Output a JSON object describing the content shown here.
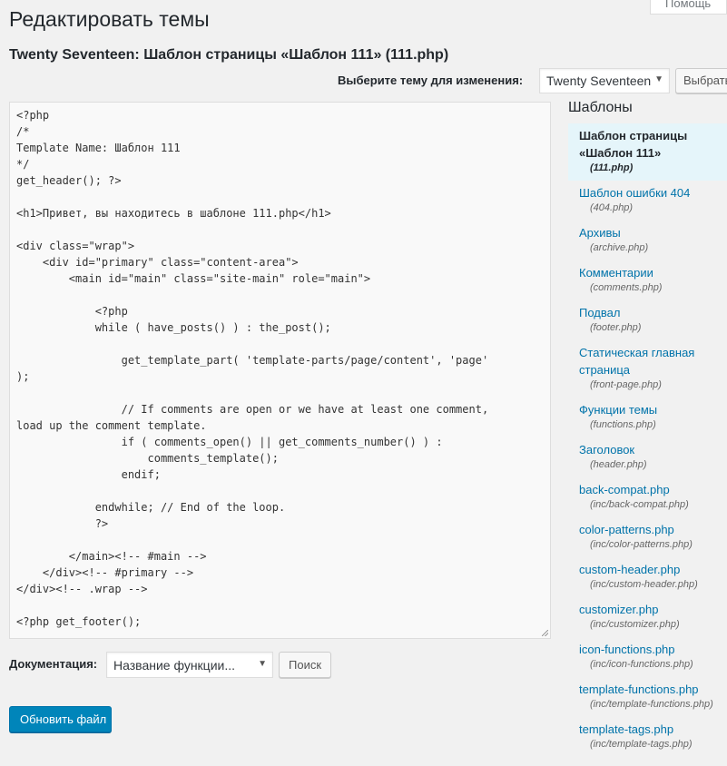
{
  "header": {
    "help_tab": "Помощь",
    "page_title": "Редактировать темы",
    "file_title": "Twenty Seventeen: Шаблон страницы «Шаблон 111» (111.php)"
  },
  "theme_picker": {
    "label": "Выберите тему для изменения:",
    "selected": "Twenty Seventeen",
    "button": "Выбрать"
  },
  "editor": {
    "code": "<?php\n/*\nTemplate Name: Шаблон 111\n*/\nget_header(); ?>\n\n<h1>Привет, вы находитесь в шаблоне 111.php</h1>\n\n<div class=\"wrap\">\n    <div id=\"primary\" class=\"content-area\">\n        <main id=\"main\" class=\"site-main\" role=\"main\">\n\n            <?php\n            while ( have_posts() ) : the_post();\n\n                get_template_part( 'template-parts/page/content', 'page'\n);\n\n                // If comments are open or we have at least one comment,\nload up the comment template.\n                if ( comments_open() || get_comments_number() ) :\n                    comments_template();\n                endif;\n\n            endwhile; // End of the loop.\n            ?>\n\n        </main><!-- #main -->\n    </div><!-- #primary -->\n</div><!-- .wrap -->\n\n<?php get_footer();"
  },
  "sidebar": {
    "title": "Шаблоны",
    "files": [
      {
        "label": "Шаблон страницы «Шаблон 111»",
        "path": "(111.php)",
        "active": true
      },
      {
        "label": "Шаблон ошибки 404",
        "path": "(404.php)"
      },
      {
        "label": "Архивы",
        "path": "(archive.php)"
      },
      {
        "label": "Комментарии",
        "path": "(comments.php)"
      },
      {
        "label": "Подвал",
        "path": "(footer.php)"
      },
      {
        "label": "Статическая главная страница",
        "path": "(front-page.php)"
      },
      {
        "label": "Функции темы",
        "path": "(functions.php)"
      },
      {
        "label": "Заголовок",
        "path": "(header.php)"
      },
      {
        "label": "back-compat.php",
        "path": "(inc/back-compat.php)"
      },
      {
        "label": "color-patterns.php",
        "path": "(inc/color-patterns.php)"
      },
      {
        "label": "custom-header.php",
        "path": "(inc/custom-header.php)"
      },
      {
        "label": "customizer.php",
        "path": "(inc/customizer.php)"
      },
      {
        "label": "icon-functions.php",
        "path": "(inc/icon-functions.php)"
      },
      {
        "label": "template-functions.php",
        "path": "(inc/template-functions.php)"
      },
      {
        "label": "template-tags.php",
        "path": "(inc/template-tags.php)"
      }
    ]
  },
  "documentation": {
    "label": "Документация:",
    "select_value": "Название функции...",
    "search_button": "Поиск"
  },
  "update_button": "Обновить файл"
}
